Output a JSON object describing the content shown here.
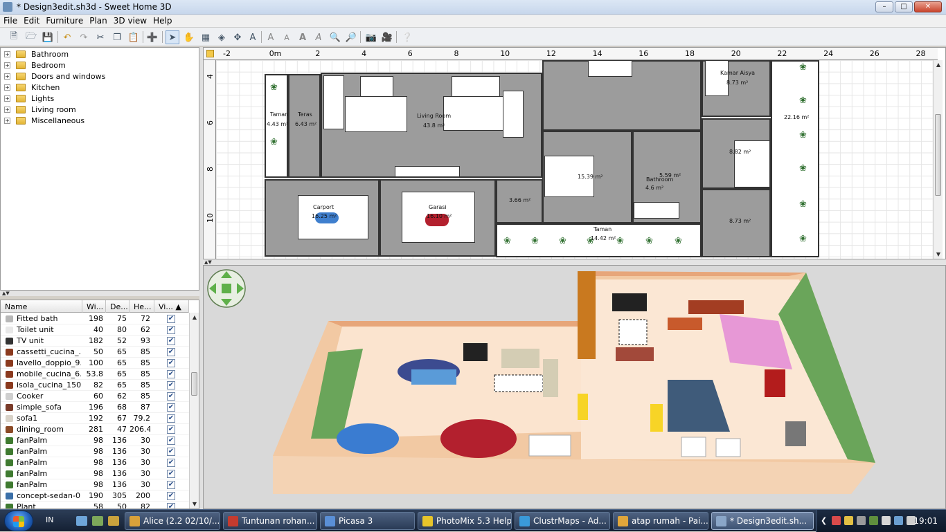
{
  "window": {
    "title": "* Design3edit.sh3d - Sweet Home 3D"
  },
  "menu": [
    "File",
    "Edit",
    "Furniture",
    "Plan",
    "3D view",
    "Help"
  ],
  "toolbar_icons": [
    "new-icon",
    "open-icon",
    "save-icon",
    "undo-icon",
    "redo-icon",
    "cut-icon",
    "copy-icon",
    "paste-icon",
    "add-furniture-icon",
    "select-icon",
    "pan-icon",
    "create-walls-icon",
    "create-rooms-icon",
    "create-dimensions-icon",
    "add-text-icon",
    "increase-text-icon",
    "decrease-text-icon",
    "bold-text-icon",
    "italic-text-icon",
    "zoom-in-icon",
    "zoom-out-icon",
    "create-photo-icon",
    "create-video-icon",
    "help-icon"
  ],
  "catalog": [
    "Bathroom",
    "Bedroom",
    "Doors and windows",
    "Kitchen",
    "Lights",
    "Living room",
    "Miscellaneous"
  ],
  "furniture_table": {
    "headers": [
      "Name",
      "Wi...",
      "De...",
      "He...",
      "Vi... ▲"
    ],
    "rows": [
      {
        "name": "Fitted bath",
        "w": "198",
        "d": "75",
        "h": "72",
        "color": "#b7b7b7"
      },
      {
        "name": "Toilet unit",
        "w": "40",
        "d": "80",
        "h": "62",
        "color": "#e8e8e8"
      },
      {
        "name": "TV unit",
        "w": "182",
        "d": "52",
        "h": "93",
        "color": "#333333"
      },
      {
        "name": "cassetti_cucina_...",
        "w": "50",
        "d": "65",
        "h": "85",
        "color": "#8b3a1e"
      },
      {
        "name": "lavello_doppio_9...",
        "w": "100",
        "d": "65",
        "h": "85",
        "color": "#8b3a1e"
      },
      {
        "name": "mobile_cucina_6...",
        "w": "53.8",
        "d": "65",
        "h": "85",
        "color": "#8b3a1e"
      },
      {
        "name": "isola_cucina_150...",
        "w": "82",
        "d": "65",
        "h": "85",
        "color": "#8b3a1e"
      },
      {
        "name": "Cooker",
        "w": "60",
        "d": "62",
        "h": "85",
        "color": "#cfcfcf"
      },
      {
        "name": "simple_sofa",
        "w": "196",
        "d": "68",
        "h": "87",
        "color": "#7a3b2a"
      },
      {
        "name": "sofa1",
        "w": "192",
        "d": "67",
        "h": "79.2",
        "color": "#d8d2c8"
      },
      {
        "name": "dining_room",
        "w": "281",
        "d": "47",
        "h": "206.4",
        "color": "#8b4a26"
      },
      {
        "name": "fanPalm",
        "w": "98",
        "d": "136",
        "h": "30",
        "color": "#3f7a30"
      },
      {
        "name": "fanPalm",
        "w": "98",
        "d": "136",
        "h": "30",
        "color": "#3f7a30"
      },
      {
        "name": "fanPalm",
        "w": "98",
        "d": "136",
        "h": "30",
        "color": "#3f7a30"
      },
      {
        "name": "fanPalm",
        "w": "98",
        "d": "136",
        "h": "30",
        "color": "#3f7a30"
      },
      {
        "name": "fanPalm",
        "w": "98",
        "d": "136",
        "h": "30",
        "color": "#3f7a30"
      },
      {
        "name": "concept-sedan-0...",
        "w": "190",
        "d": "305",
        "h": "200",
        "color": "#3a6fa8"
      },
      {
        "name": "Plant",
        "w": "58",
        "d": "50",
        "h": "82",
        "color": "#3f7a30"
      }
    ]
  },
  "plan": {
    "ruler_x": [
      "-2",
      "0m",
      "2",
      "4",
      "6",
      "8",
      "10",
      "12",
      "14",
      "16",
      "18",
      "20",
      "22",
      "24",
      "26",
      "28"
    ],
    "ruler_y": [
      "4",
      "6",
      "8",
      "10"
    ],
    "rooms": [
      {
        "name": "Living Room",
        "area": "43.8 m²"
      },
      {
        "name": "Kamar Aisya",
        "area": "8.73 m²"
      },
      {
        "name": "Taman",
        "area": "4.43 m²"
      },
      {
        "name": "Teras",
        "area": "6.43 m²"
      },
      {
        "name": "Carport",
        "area": "16.25 m²"
      },
      {
        "name": "Garasi",
        "area": "16.10 m²"
      },
      {
        "name": "",
        "area": "3.66 m²"
      },
      {
        "name": "",
        "area": "15.39 m²"
      },
      {
        "name": "Bathroom",
        "area": "5.59 m²"
      },
      {
        "name": "",
        "area": "4.6 m²"
      },
      {
        "name": "",
        "area": "8.82 m²"
      },
      {
        "name": "",
        "area": "8.73 m²"
      },
      {
        "name": "",
        "area": "22.16 m²"
      },
      {
        "name": "Taman",
        "area": "14.42 m²"
      }
    ]
  },
  "taskbar": {
    "lang": "IN",
    "tasks": [
      {
        "label": "Alice (2.2  02/10/...",
        "color": "#d9a13a"
      },
      {
        "label": "Tuntunan rohan...",
        "color": "#c43b2f"
      },
      {
        "label": "Picasa 3",
        "color": "#5a8fd6"
      },
      {
        "label": "PhotoMix 5.3 Help",
        "color": "#e8c52a"
      },
      {
        "label": "ClustrMaps - Ad...",
        "color": "#3a9ad9"
      },
      {
        "label": "atap rumah - Pai...",
        "color": "#e0a63b"
      },
      {
        "label": "* Design3edit.sh...",
        "color": "#8aa6c8"
      }
    ],
    "clock": "19:01"
  }
}
